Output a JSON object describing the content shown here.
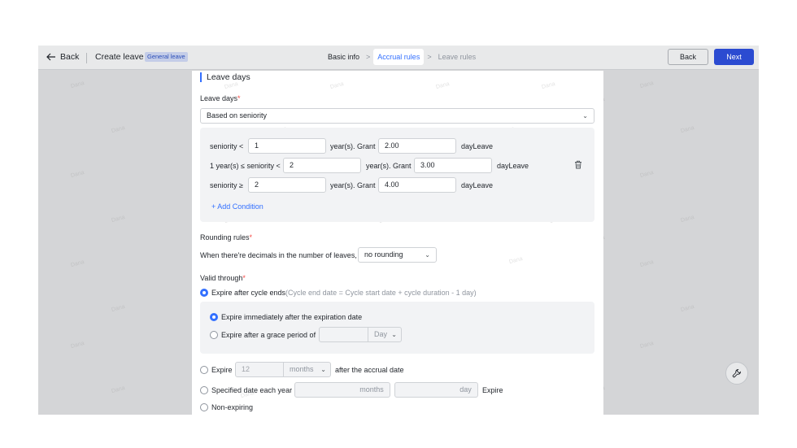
{
  "header": {
    "back_label": "Back",
    "title": "Create leave",
    "badge": "General leave",
    "steps": [
      "Basic info",
      "Accrual rules",
      "Leave rules"
    ],
    "btn_back": "Back",
    "btn_next": "Next"
  },
  "watermark_text": "Dana",
  "section": {
    "title": "Leave days"
  },
  "leave_days": {
    "label": "Leave days",
    "required_mark": "*",
    "basis": "Based on seniority"
  },
  "conditions": [
    {
      "prefix": "seniority <",
      "value1": "1",
      "mid": "year(s). Grant",
      "grant": "2.00",
      "suffix": "dayLeave"
    },
    {
      "prefix": "1 year(s) ≤ seniority <",
      "value1": "2",
      "mid": "year(s). Grant",
      "grant": "3.00",
      "suffix": "dayLeave"
    },
    {
      "prefix": "seniority ≥",
      "value1": "2",
      "mid": "year(s). Grant",
      "grant": "4.00",
      "suffix": "dayLeave"
    }
  ],
  "add_condition": "+ Add Condition",
  "rounding": {
    "label": "Rounding rules",
    "required_mark": "*",
    "desc": "When there're decimals in the number of leaves,",
    "value": "no rounding"
  },
  "valid": {
    "label": "Valid through",
    "required_mark": "*",
    "opt1_label": "Expire after cycle ends",
    "opt1_hint": "(Cycle end date = Cycle start date + cycle duration - 1 day)",
    "sub1": "Expire immediately after the expiration date",
    "sub2": "Expire after a grace period of",
    "sub2_unit": "Day",
    "opt2_label": "Expire",
    "opt2_value": "12",
    "opt2_unit": "months",
    "opt2_after": "after the accrual date",
    "opt3_label": "Specified date each year",
    "opt3_unit1": "months",
    "opt3_unit2": "day",
    "opt3_after": "Expire",
    "opt4_label": "Non-expiring"
  }
}
